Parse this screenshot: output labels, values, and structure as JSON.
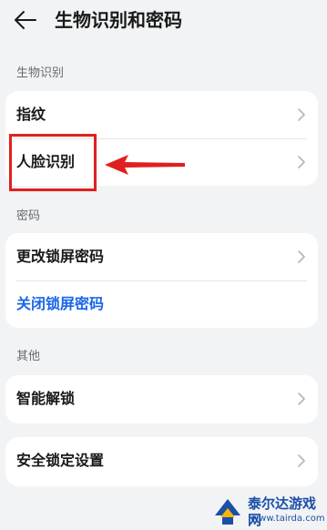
{
  "header": {
    "title": "生物识别和密码"
  },
  "sections": [
    {
      "label": "生物识别",
      "items": [
        {
          "label": "指纹"
        },
        {
          "label": "人脸识别"
        }
      ]
    },
    {
      "label": "密码",
      "items": [
        {
          "label": "更改锁屏密码"
        },
        {
          "label": "关闭锁屏密码"
        }
      ]
    },
    {
      "label": "其他",
      "items": [
        {
          "label": "智能解锁"
        }
      ]
    },
    {
      "items": [
        {
          "label": "安全锁定设置"
        }
      ]
    }
  ],
  "watermark": {
    "name": "泰尔达游戏网",
    "url": "www.tairda.com"
  },
  "colors": {
    "accent": "#1a66e8",
    "highlight": "#e02020",
    "background": "#f1f3f5"
  }
}
